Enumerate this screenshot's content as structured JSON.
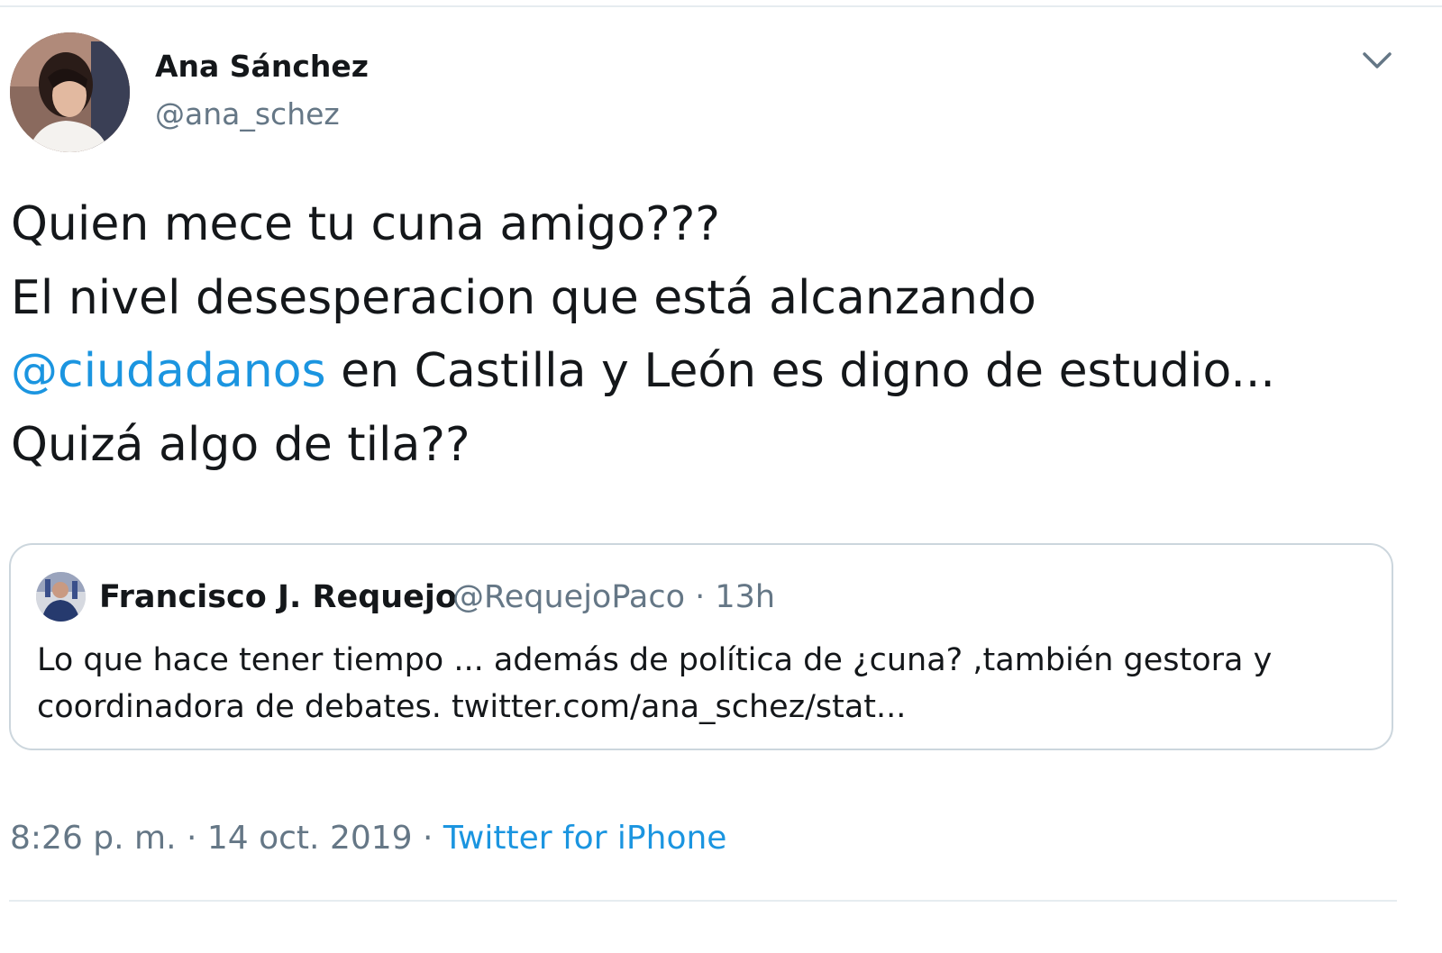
{
  "author": {
    "name": "Ana Sánchez",
    "handle": "@ana_schez",
    "avatar_icon": "user-photo-avatar"
  },
  "tweet": {
    "lines": [
      "Quien mece tu cuna amigo???",
      "El nivel desesperacion que está alcanzando",
      "en Castilla y León es digno de estudio...",
      "Quizá algo de tila??"
    ],
    "mention": "@ciudadanos",
    "mention_color": "#1b95e0"
  },
  "quoted_tweet": {
    "name": "Francisco J. Requejo",
    "handle_time": "@RequejoPaco · 13h",
    "text_lines": [
      "Lo que hace tener tiempo ...  además de política de ¿cuna? ,también gestora y",
      "coordinadora de debates. twitter.com/ana_schez/stat..."
    ],
    "avatar_icon": "user-photo-avatar"
  },
  "footer": {
    "timestamp": "8:26 p. m. · 14 oct. 2019 · ",
    "source": "Twitter for iPhone",
    "source_color": "#1b95e0"
  },
  "menu_icon": "chevron-down-icon"
}
